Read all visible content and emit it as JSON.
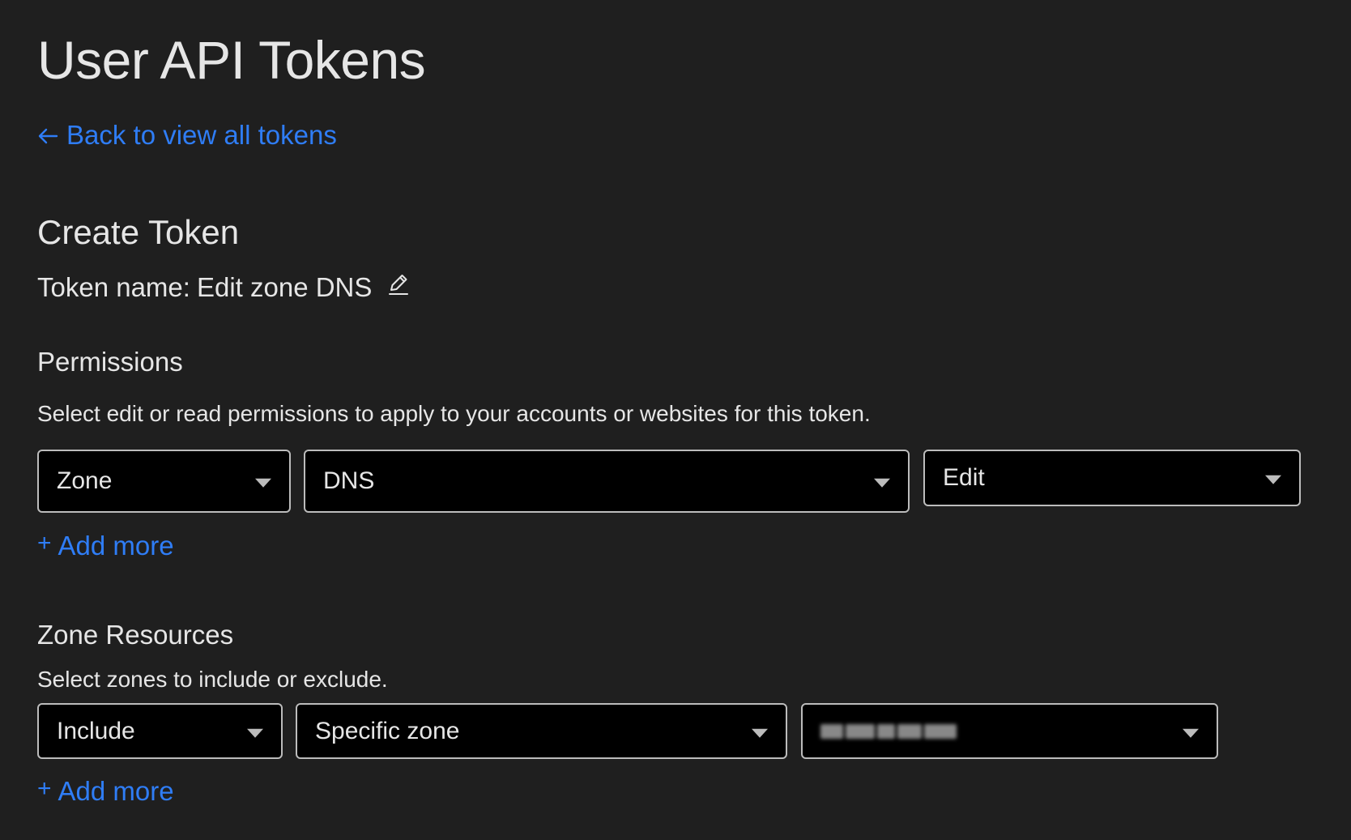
{
  "header": {
    "title": "User API Tokens",
    "back_link": "Back to view all tokens",
    "back_icon": "arrow-left-icon"
  },
  "create": {
    "title": "Create Token",
    "token_name_label": "Token name:",
    "token_name_value": "Edit zone DNS",
    "edit_icon": "pencil-icon"
  },
  "permissions": {
    "title": "Permissions",
    "description": "Select edit or read permissions to apply to your accounts or websites for this token.",
    "selects": [
      "Zone",
      "DNS",
      "Edit"
    ],
    "add_more": "Add more"
  },
  "zone_resources": {
    "title": "Zone Resources",
    "description": "Select zones to include or exclude.",
    "selects": [
      "Include",
      "Specific zone",
      ""
    ],
    "add_more": "Add more"
  },
  "colors": {
    "background": "#1f1f1f",
    "link": "#2f7df6",
    "select_bg": "#000000",
    "select_border": "#bcbcbc"
  }
}
